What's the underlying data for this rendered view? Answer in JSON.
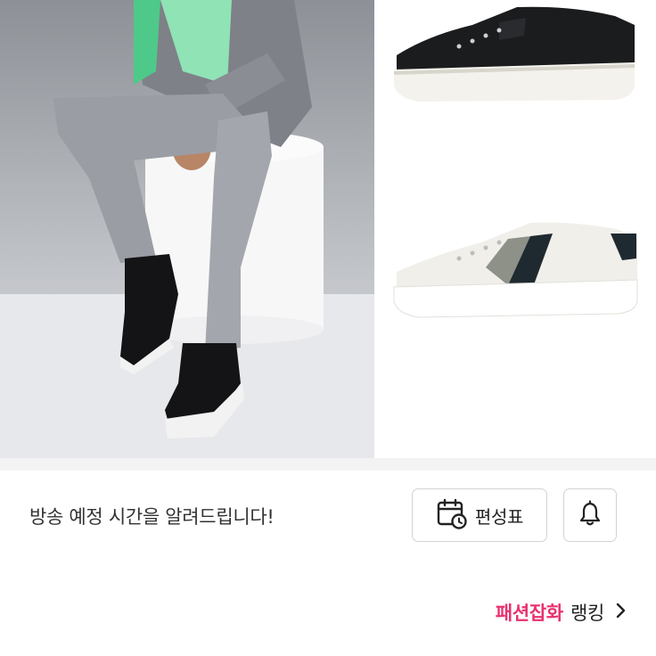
{
  "banner": {
    "main_image": "man-seated-wearing-black-sneakers",
    "side_images": [
      "black-sneaker-product",
      "white-striped-sneaker-product"
    ]
  },
  "schedule": {
    "message": "방송 예정 시간을 알려드립니다!",
    "schedule_button_label": "편성표",
    "schedule_icon": "calendar-clock-icon",
    "alarm_icon": "bell-icon"
  },
  "ranking": {
    "category": "패션잡화",
    "label": "랭킹",
    "icon": "chevron-right-icon",
    "accent_color": "#e8326e"
  }
}
